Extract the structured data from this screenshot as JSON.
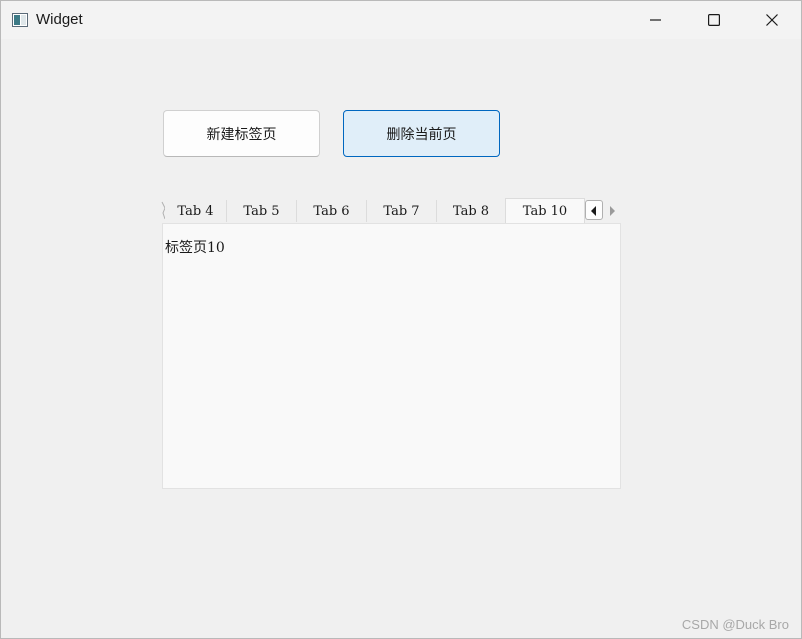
{
  "window": {
    "title": "Widget"
  },
  "controls": {
    "minimize_icon": "minimize-icon",
    "maximize_icon": "maximize-icon",
    "close_icon": "close-icon"
  },
  "buttons": {
    "new_tab": "新建标签页",
    "delete_tab": "删除当前页"
  },
  "tabs": [
    {
      "label": "Tab 4",
      "selected": false
    },
    {
      "label": "Tab 5",
      "selected": false
    },
    {
      "label": "Tab 6",
      "selected": false
    },
    {
      "label": "Tab 7",
      "selected": false
    },
    {
      "label": "Tab 8",
      "selected": false
    },
    {
      "label": "Tab 10",
      "selected": true
    }
  ],
  "tab_scroll": {
    "left_icon": "triangle-left-icon",
    "right_icon": "triangle-right-icon"
  },
  "pane": {
    "content": "标签页10"
  },
  "watermark": "CSDN @Duck Bro",
  "colors": {
    "window_bg": "#f0f0f0",
    "accent_border": "#0067c0",
    "accent_fill": "#e0eef9",
    "pane_bg": "#f9f9f9"
  }
}
